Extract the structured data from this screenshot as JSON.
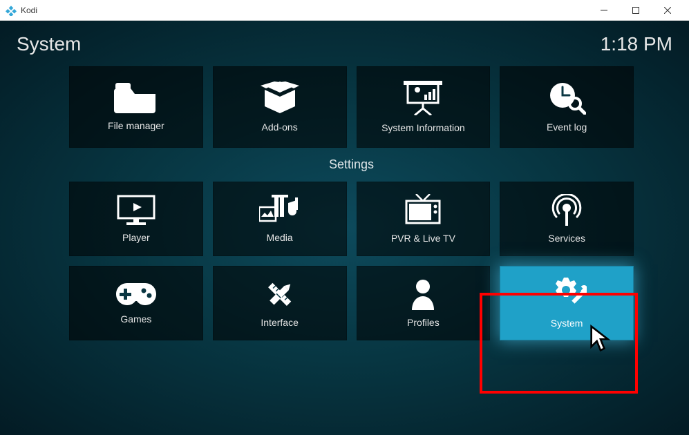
{
  "window": {
    "app_name": "Kodi"
  },
  "header": {
    "section": "System",
    "clock": "1:18 PM"
  },
  "settings_label": "Settings",
  "tiles": {
    "file_manager": "File manager",
    "addons": "Add-ons",
    "system_info": "System Information",
    "event_log": "Event log",
    "player": "Player",
    "media": "Media",
    "pvr": "PVR & Live TV",
    "services": "Services",
    "games": "Games",
    "interface": "Interface",
    "profiles": "Profiles",
    "system": "System"
  }
}
